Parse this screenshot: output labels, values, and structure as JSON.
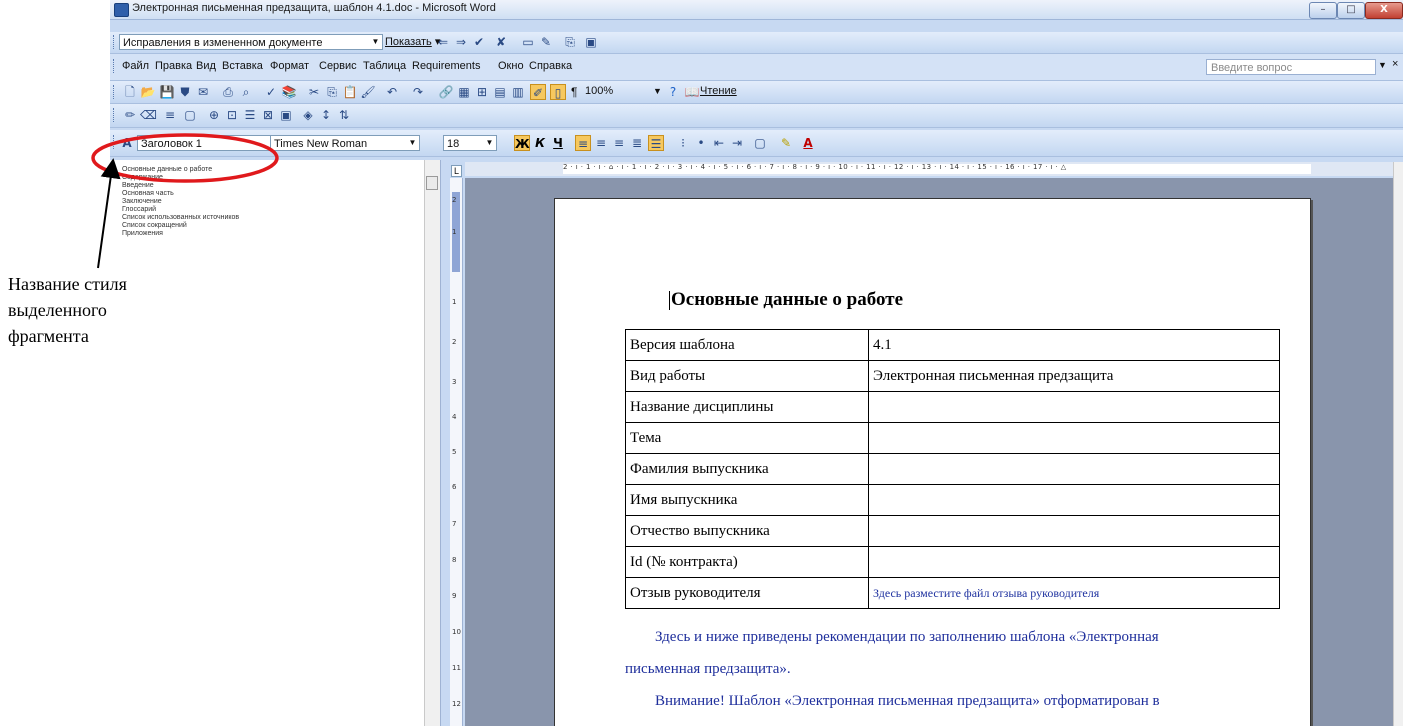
{
  "window": {
    "title": "Электронная письменная предзащита, шаблон 4.1.doc - Microsoft Word",
    "min_label": "–",
    "max_label": "□",
    "close_label": "X"
  },
  "reviewing_toolbar": {
    "display_value": "Исправления в измененном документе",
    "show_label": "Показать"
  },
  "menu": {
    "items": [
      "Файл",
      "Правка",
      "Вид",
      "Вставка",
      "Формат",
      "Сервис",
      "Таблица",
      "Requirements",
      "Окно",
      "Справка"
    ],
    "ask_placeholder": "Введите вопрос",
    "close_glyph": "×"
  },
  "standard_toolbar": {
    "zoom": "100%",
    "reading_label": "Чтение",
    "pilcrow": "¶"
  },
  "formatting_toolbar": {
    "style": "Заголовок 1",
    "font": "Times New Roman",
    "size": "18",
    "bold": "Ж",
    "italic": "К",
    "underline": "Ч"
  },
  "document_map": {
    "items": [
      "Основные данные о работе",
      "Содержание",
      "Введение",
      "Основная часть",
      "Заключение",
      "Глоссарий",
      "Список использованных источников",
      "Список сокращений",
      "Приложения"
    ]
  },
  "ruler": {
    "tab_glyph": "L",
    "numbers": "2 · ı · 1 · ı · ⌂ · ı · 1 · ı · 2 · ı · 3 · ı · 4 · ı · 5 · ı · 6 · ı · 7 · ı · 8 · ı · 9 · ı · 10 · ı · 11 · ı · 12 · ı · 13 · ı · 14 · ı · 15 · ı · 16 · ı · 17 · ı · △",
    "vertical": [
      "2",
      "1",
      "1",
      "2",
      "3",
      "4",
      "5",
      "6",
      "7",
      "8",
      "9",
      "10",
      "11",
      "12"
    ]
  },
  "document": {
    "heading": "Основные данные о работе",
    "table": [
      [
        "Версия шаблона",
        "4.1"
      ],
      [
        "Вид работы",
        "Электронная письменная предзащита"
      ],
      [
        "Название дисциплины",
        ""
      ],
      [
        "Тема",
        ""
      ],
      [
        "Фамилия выпускника",
        ""
      ],
      [
        "Имя выпускника",
        ""
      ],
      [
        "Отчество выпускника",
        ""
      ],
      [
        "Id (№ контракта)",
        ""
      ],
      [
        "Отзыв руководителя",
        "Здесь разместите файл отзыва руководителя"
      ]
    ],
    "para1_line1": "Здесь и ниже приведены рекомендации по заполнению шаблона «Электронная",
    "para1_line2": "письменная предзащита».",
    "para2_line1": "Внимание! Шаблон «Электронная письменная предзащита» отформатирован в"
  },
  "annotation": {
    "lines": [
      "Название стиля",
      "выделенного",
      "фрагмента"
    ],
    "color": "#e0191c"
  }
}
